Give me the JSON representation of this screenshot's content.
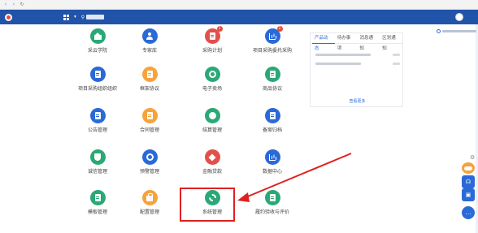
{
  "browser": {
    "url": ""
  },
  "header": {
    "brand": "",
    "app_center": "",
    "right_items": [
      {
        "label": "",
        "badge": ""
      },
      {
        "label": "",
        "badge": ""
      },
      {
        "label": "",
        "badge": ""
      },
      {
        "label": "",
        "badge": ""
      },
      {
        "label": "",
        "badge": ""
      }
    ],
    "user_name": ""
  },
  "tiles": [
    {
      "label": "采云学院",
      "color": "#2aa876",
      "glyph": "house",
      "badge": ""
    },
    {
      "label": "专家库",
      "color": "#2a6ad8",
      "glyph": "person",
      "badge": ""
    },
    {
      "label": "采购计划",
      "color": "#e2504a",
      "glyph": "doc",
      "badge": "1"
    },
    {
      "label": "项目采购委托采购",
      "color": "#2a6ad8",
      "glyph": "chart",
      "badge": "2"
    },
    {
      "label": "项目采购组织组织",
      "color": "#2a6ad8",
      "glyph": "doc",
      "badge": ""
    },
    {
      "label": "框架协议",
      "color": "#f7a23b",
      "glyph": "doc",
      "badge": ""
    },
    {
      "label": "电子卖场",
      "color": "#2aa876",
      "glyph": "circle",
      "badge": ""
    },
    {
      "label": "商品协议",
      "color": "#2aa876",
      "glyph": "doc",
      "badge": ""
    },
    {
      "label": "公告管理",
      "color": "#2a6ad8",
      "glyph": "doc",
      "badge": ""
    },
    {
      "label": "合同管理",
      "color": "#f7a23b",
      "glyph": "doc",
      "badge": ""
    },
    {
      "label": "结算管理",
      "color": "#2aa876",
      "glyph": "coin",
      "badge": ""
    },
    {
      "label": "备案归档",
      "color": "#2a6ad8",
      "glyph": "doc",
      "badge": ""
    },
    {
      "label": "诚信管理",
      "color": "#2aa876",
      "glyph": "shield",
      "badge": ""
    },
    {
      "label": "预警管理",
      "color": "#2a6ad8",
      "glyph": "circle",
      "badge": ""
    },
    {
      "label": "金融贷款",
      "color": "#e2504a",
      "glyph": "box",
      "badge": ""
    },
    {
      "label": "数据中心",
      "color": "#2a6ad8",
      "glyph": "chart",
      "badge": ""
    },
    {
      "label": "模板管理",
      "color": "#2aa876",
      "glyph": "doc",
      "badge": ""
    },
    {
      "label": "配置管理",
      "color": "#f7a23b",
      "glyph": "bag",
      "badge": ""
    },
    {
      "label": "系统管理",
      "color": "#2aa876",
      "glyph": "gear",
      "badge": ""
    },
    {
      "label": "履约验收与评价",
      "color": "#2aa876",
      "glyph": "doc",
      "badge": ""
    }
  ],
  "notices": {
    "tabs": [
      {
        "label": "产品动态",
        "active": true
      },
      {
        "label": "待办事项",
        "active": false
      },
      {
        "label": "消息通知",
        "active": false
      },
      {
        "label": "区划通知",
        "active": false
      }
    ],
    "items": [
      {
        "title": "",
        "time": ""
      },
      {
        "title": "",
        "time": ""
      }
    ],
    "more": "查看更多"
  },
  "sidebar": {
    "switch_label": ""
  },
  "colors": {
    "header": "#2153a8",
    "accent": "#2a6ad8",
    "highlight": "#e02020"
  }
}
